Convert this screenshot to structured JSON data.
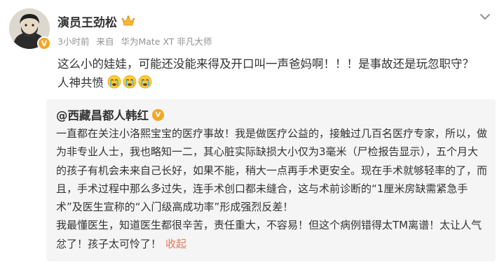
{
  "post": {
    "username": "演员王劲松",
    "time": "3小时前",
    "source_prefix": "来自",
    "source": "华为Mate XT 非凡大师",
    "badge_glyph": "V",
    "text_line1": "这么小的娃娃，可能还没能来得及开口叫一声爸妈啊！！！是事故还是玩忽职守？",
    "text_line2": "人神共愤",
    "emojis": [
      "crying-face",
      "crying-face",
      "crying-face"
    ]
  },
  "repost": {
    "author": "@西藏昌都人韩红",
    "badge_glyph": "V",
    "paragraph1": "一直都在关注小洛熙宝宝的医疗事故！我是做医疗公益的，接触过几百名医疗专家，所以，做为非专业人士，我也略知一二，其心脏实际缺损大小仅为3毫米（尸检报告显示），五个月大的孩子有机会未来自己长好，如果不能，稍大一点再手术更安全。现在手术就够轻率的了，而且，手术过程中那么多过失，连手术创口都未缝合，这与术前诊断的“1厘米房缺需紧急手术”及医生宣称的“入门级高成功率”形成强烈反差！",
    "paragraph2": "我最懂医生，知道医生都很辛苦，责任重大，不容易！但这个病例错得太TM离谱！太让人气忿了！孩子太可怜了！",
    "collapse_label": "收起"
  },
  "colors": {
    "text": "#333333",
    "meta": "#939393",
    "repost_bg": "#f5f5f5",
    "link": "#eb7350",
    "verified": "#f5a623"
  }
}
